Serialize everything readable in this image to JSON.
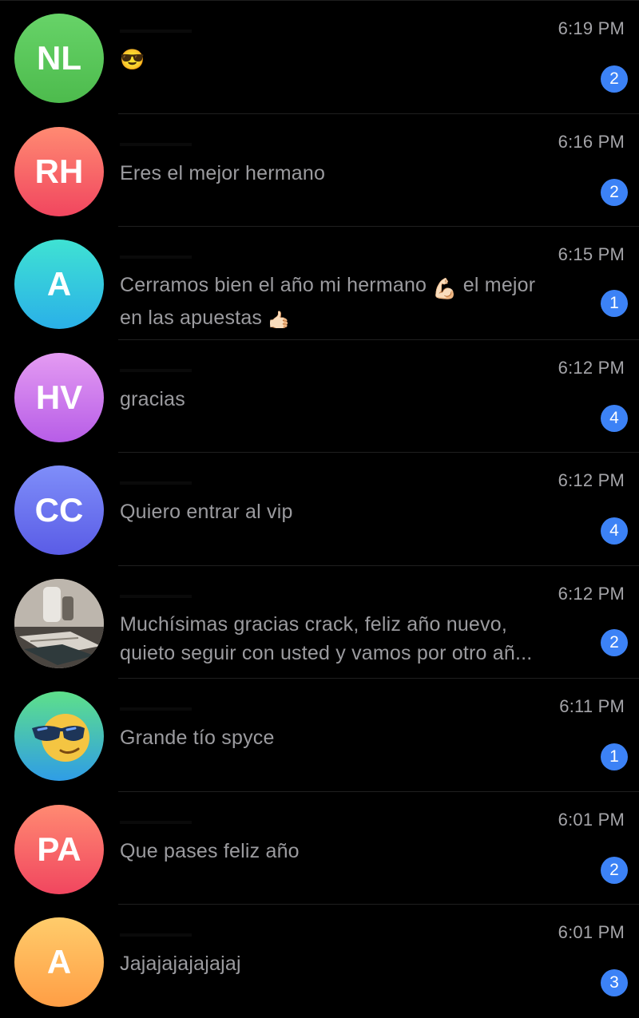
{
  "chats": [
    {
      "avatar_initials": "NL",
      "avatar_color_top": "#67d368",
      "avatar_color_bottom": "#4dbb4d",
      "time": "6:19 PM",
      "preview": "😎",
      "unread": "2"
    },
    {
      "avatar_initials": "RH",
      "avatar_color_top": "#ff8a72",
      "avatar_color_bottom": "#f1465f",
      "time": "6:16 PM",
      "preview": "Eres el mejor hermano",
      "unread": "2"
    },
    {
      "avatar_initials": "A",
      "avatar_color_top": "#3fe2d3",
      "avatar_color_bottom": "#2ab0e8",
      "time": "6:15 PM",
      "preview_line1": "Cerramos bien el año mi hermano",
      "preview_emoji1": "💪🏻",
      "preview_line1_end": "el mejor",
      "preview_line2": "en las apuestas",
      "preview_emoji2": "🤙🏻",
      "unread": "1"
    },
    {
      "avatar_initials": "HV",
      "avatar_color_top": "#e49bf2",
      "avatar_color_bottom": "#b75de7",
      "time": "6:12 PM",
      "preview": "gracias",
      "unread": "4"
    },
    {
      "avatar_initials": "CC",
      "avatar_color_top": "#7f8ef9",
      "avatar_color_bottom": "#5a5ce6",
      "time": "6:12 PM",
      "preview": "Quiero entrar al vip",
      "unread": "4"
    },
    {
      "avatar_type": "photo",
      "time": "6:12 PM",
      "preview_line1": "Muchísimas gracias crack, feliz año nuevo,",
      "preview_line2": "quieto seguir con usted y vamos por otro añ...",
      "unread": "2"
    },
    {
      "avatar_type": "emoji",
      "avatar_color_top": "#5ee08a",
      "avatar_color_bottom": "#2f9de6",
      "time": "6:11 PM",
      "preview": "Grande tío spyce",
      "unread": "1"
    },
    {
      "avatar_initials": "PA",
      "avatar_color_top": "#ff8a72",
      "avatar_color_bottom": "#f1465f",
      "time": "6:01 PM",
      "preview": "Que pases feliz año",
      "unread": "2"
    },
    {
      "avatar_initials": "A",
      "avatar_color_top": "#ffcc6b",
      "avatar_color_bottom": "#ff9e45",
      "time": "6:01 PM",
      "preview": "Jajajajajajajaj",
      "unread": "3"
    }
  ],
  "colors": {
    "background": "#000000",
    "preview_text": "#9b9b9f",
    "time_text": "#a4a4a8",
    "badge": "#3c82f6"
  }
}
